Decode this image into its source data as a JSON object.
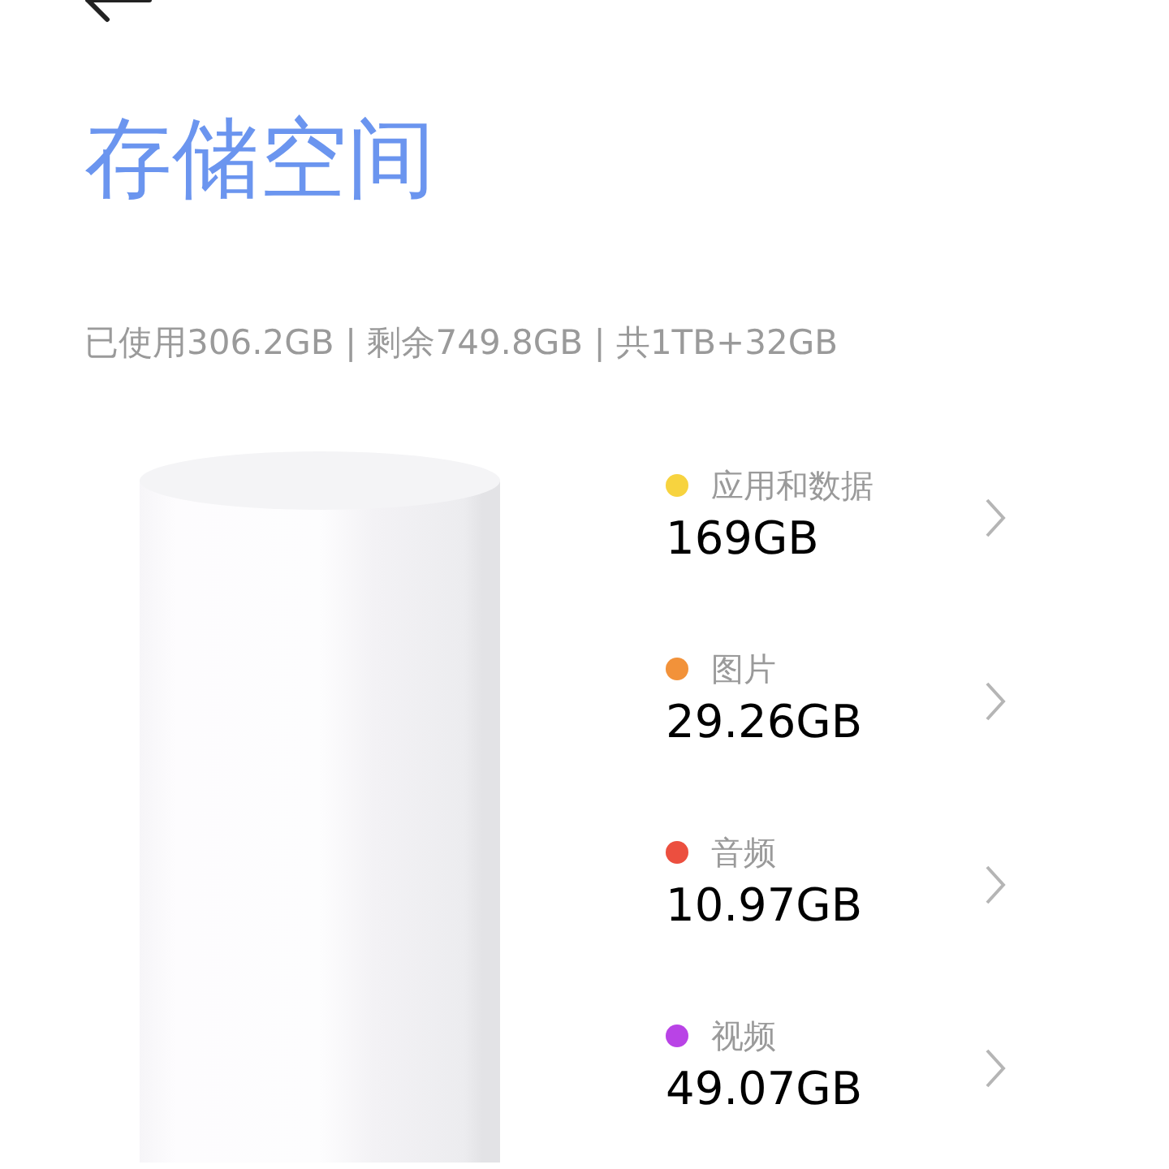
{
  "title": "存储空间",
  "summary": "已使用306.2GB | 剩余749.8GB | 共1TB+32GB",
  "categories": [
    {
      "label": "应用和数据",
      "value": "169GB",
      "color": "#f7d33f"
    },
    {
      "label": "图片",
      "value": "29.26GB",
      "color": "#f2923a"
    },
    {
      "label": "音频",
      "value": "10.97GB",
      "color": "#ec4f3f"
    },
    {
      "label": "视频",
      "value": "49.07GB",
      "color": "#b943e6"
    }
  ]
}
